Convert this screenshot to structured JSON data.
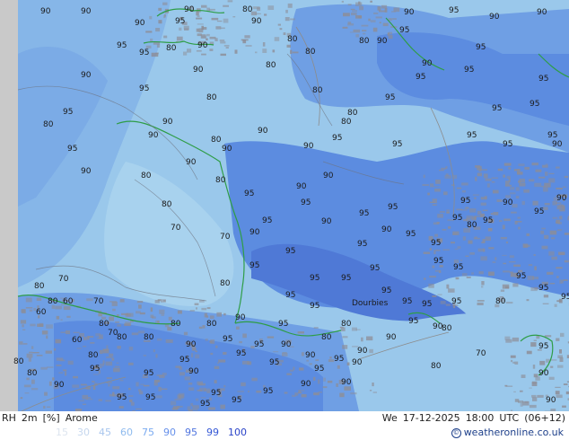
{
  "map": {
    "city": "Dourbies",
    "contour_labels": [
      [
        "90",
        45,
        7
      ],
      [
        "90",
        90,
        7
      ],
      [
        "90",
        150,
        20
      ],
      [
        "95",
        195,
        18
      ],
      [
        "90",
        205,
        5
      ],
      [
        "80",
        270,
        5
      ],
      [
        "90",
        280,
        18
      ],
      [
        "80",
        185,
        48
      ],
      [
        "90",
        220,
        45
      ],
      [
        "90",
        215,
        72
      ],
      [
        "95",
        130,
        45
      ],
      [
        "95",
        155,
        53
      ],
      [
        "90",
        90,
        78
      ],
      [
        "95",
        155,
        93
      ],
      [
        "80",
        230,
        103
      ],
      [
        "90",
        181,
        130
      ],
      [
        "95",
        70,
        119
      ],
      [
        "80",
        48,
        133
      ],
      [
        "90",
        165,
        145
      ],
      [
        "80",
        235,
        150
      ],
      [
        "90",
        247,
        160
      ],
      [
        "95",
        75,
        160
      ],
      [
        "90",
        90,
        185
      ],
      [
        "80",
        157,
        190
      ],
      [
        "90",
        207,
        175
      ],
      [
        "80",
        240,
        195
      ],
      [
        "80",
        180,
        222
      ],
      [
        "70",
        190,
        248
      ],
      [
        "70",
        245,
        258
      ],
      [
        "80",
        38,
        313
      ],
      [
        "70",
        65,
        305
      ],
      [
        "80",
        245,
        310
      ],
      [
        "80",
        320,
        38
      ],
      [
        "80",
        340,
        52
      ],
      [
        "80",
        296,
        67
      ],
      [
        "80",
        348,
        95
      ],
      [
        "80",
        387,
        120
      ],
      [
        "80",
        380,
        130
      ],
      [
        "90",
        287,
        140
      ],
      [
        "90",
        338,
        157
      ],
      [
        "95",
        370,
        148
      ],
      [
        "90",
        360,
        190
      ],
      [
        "90",
        330,
        202
      ],
      [
        "95",
        335,
        220
      ],
      [
        "95",
        272,
        210
      ],
      [
        "95",
        292,
        240
      ],
      [
        "90",
        358,
        241
      ],
      [
        "90",
        278,
        253
      ],
      [
        "95",
        278,
        290
      ],
      [
        "95",
        318,
        274
      ],
      [
        "95",
        345,
        304
      ],
      [
        "95",
        318,
        323
      ],
      [
        "90",
        262,
        348
      ],
      [
        "80",
        400,
        40
      ],
      [
        "90",
        420,
        40
      ],
      [
        "90",
        450,
        8
      ],
      [
        "95",
        500,
        6
      ],
      [
        "90",
        545,
        13
      ],
      [
        "90",
        598,
        8
      ],
      [
        "95",
        445,
        28
      ],
      [
        "90",
        470,
        65
      ],
      [
        "95",
        463,
        80
      ],
      [
        "95",
        429,
        103
      ],
      [
        "95",
        437,
        155
      ],
      [
        "95",
        517,
        72
      ],
      [
        "95",
        530,
        47
      ],
      [
        "95",
        548,
        115
      ],
      [
        "95",
        520,
        145
      ],
      [
        "95",
        560,
        155
      ],
      [
        "95",
        590,
        110
      ],
      [
        "95",
        600,
        82
      ],
      [
        "95",
        610,
        145
      ],
      [
        "90",
        615,
        155
      ],
      [
        "90",
        620,
        215
      ],
      [
        "90",
        560,
        220
      ],
      [
        "95",
        595,
        230
      ],
      [
        "95",
        432,
        225
      ],
      [
        "95",
        400,
        232
      ],
      [
        "95",
        398,
        266
      ],
      [
        "90",
        425,
        250
      ],
      [
        "95",
        452,
        255
      ],
      [
        "95",
        480,
        265
      ],
      [
        "95",
        513,
        218
      ],
      [
        "95",
        504,
        237
      ],
      [
        "80",
        520,
        245
      ],
      [
        "95",
        538,
        240
      ],
      [
        "95",
        483,
        285
      ],
      [
        "95",
        505,
        292
      ],
      [
        "95",
        412,
        293
      ],
      [
        "95",
        425,
        318
      ],
      [
        "95",
        448,
        330
      ],
      [
        "95",
        470,
        333
      ],
      [
        "95",
        503,
        330
      ],
      [
        "80",
        552,
        330
      ],
      [
        "95",
        575,
        302
      ],
      [
        "95",
        600,
        315
      ],
      [
        "95",
        625,
        325
      ],
      [
        "95",
        380,
        304
      ],
      [
        "95",
        345,
        335
      ],
      [
        "80",
        380,
        355
      ],
      [
        "80",
        358,
        370
      ],
      [
        "90",
        398,
        385
      ],
      [
        "90",
        430,
        370
      ],
      [
        "95",
        455,
        352
      ],
      [
        "90",
        482,
        358
      ],
      [
        "80",
        492,
        360
      ],
      [
        "70",
        530,
        388
      ],
      [
        "80",
        480,
        402
      ],
      [
        "95",
        600,
        380
      ],
      [
        "90",
        600,
        410
      ],
      [
        "90",
        608,
        440
      ],
      [
        "80",
        110,
        355
      ],
      [
        "70",
        120,
        365
      ],
      [
        "80",
        190,
        355
      ],
      [
        "80",
        230,
        355
      ],
      [
        "90",
        207,
        378
      ],
      [
        "95",
        248,
        372
      ],
      [
        "95",
        283,
        378
      ],
      [
        "90",
        313,
        378
      ],
      [
        "90",
        340,
        390
      ],
      [
        "95",
        300,
        398
      ],
      [
        "95",
        372,
        394
      ],
      [
        "90",
        392,
        398
      ],
      [
        "90",
        210,
        408
      ],
      [
        "95",
        160,
        410
      ],
      [
        "95",
        100,
        405
      ],
      [
        "80",
        98,
        390
      ],
      [
        "90",
        60,
        423
      ],
      [
        "95",
        130,
        437
      ],
      [
        "95",
        162,
        437
      ],
      [
        "95",
        223,
        444
      ],
      [
        "95",
        258,
        440
      ],
      [
        "95",
        293,
        430
      ],
      [
        "90",
        335,
        422
      ],
      [
        "95",
        350,
        405
      ],
      [
        "90",
        380,
        420
      ],
      [
        "70",
        104,
        330
      ],
      [
        "60",
        70,
        330
      ],
      [
        "80",
        53,
        330
      ],
      [
        "60",
        40,
        342
      ],
      [
        "60",
        80,
        373
      ],
      [
        "80",
        15,
        397
      ],
      [
        "80",
        30,
        410
      ],
      [
        "80",
        130,
        370
      ],
      [
        "80",
        160,
        370
      ],
      [
        "95",
        235,
        432
      ],
      [
        "95",
        200,
        395
      ],
      [
        "95",
        263,
        388
      ],
      [
        "95",
        310,
        355
      ]
    ],
    "colors": {
      "land_pale": "#9ac8eb",
      "sea_light": "#86b6e8",
      "band_90": "#6f9fe4",
      "band_95": "#5c8ce0",
      "band_99": "#4f79d6",
      "relief_gray": "#8d8d96",
      "coast_green": "#2e9d46",
      "border_gray": "#8c8c8c",
      "contour_gray": "#6e7480"
    }
  },
  "footer": {
    "product": {
      "variable": "RH",
      "level": "2m",
      "unit": "[%]",
      "model": "Arome"
    },
    "valid": {
      "day": "We",
      "date": "17-12-2025",
      "time": "18:00",
      "zone": "UTC",
      "run": "(06+12)"
    },
    "legend": [
      {
        "label": "15",
        "color": "#dde5ef"
      },
      {
        "label": "30",
        "color": "#c6d7ee"
      },
      {
        "label": "45",
        "color": "#a9c6ee"
      },
      {
        "label": "60",
        "color": "#8fbbee"
      },
      {
        "label": "75",
        "color": "#7aaaf0"
      },
      {
        "label": "90",
        "color": "#6690ea"
      },
      {
        "label": "95",
        "color": "#4f74df"
      },
      {
        "label": "99",
        "color": "#3558d6"
      },
      {
        "label": "100",
        "color": "#2a43c8"
      }
    ],
    "credit": "weatheronline.co.uk",
    "credit_symbol": "©"
  }
}
